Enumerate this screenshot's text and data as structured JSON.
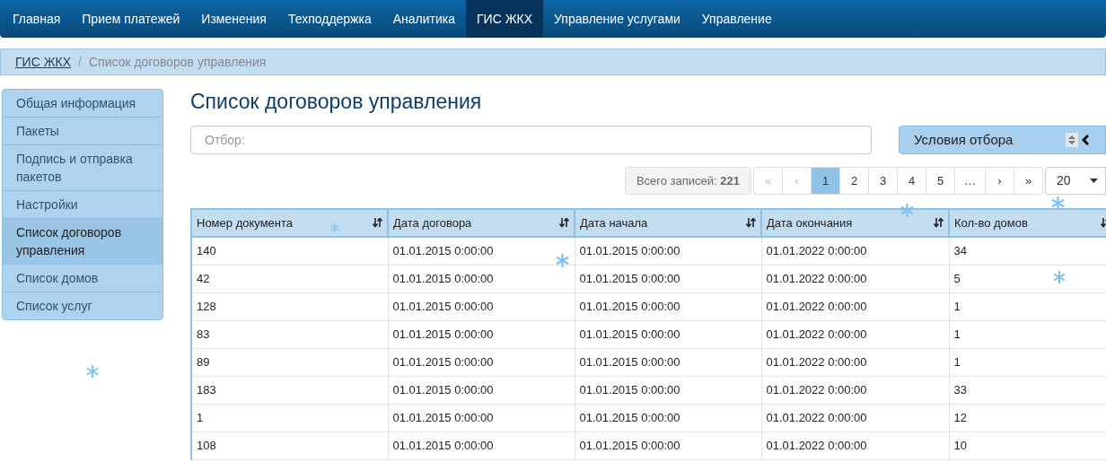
{
  "navbar": {
    "items": [
      {
        "label": "Главная",
        "selected": false
      },
      {
        "label": "Прием платежей",
        "selected": false
      },
      {
        "label": "Изменения",
        "selected": false
      },
      {
        "label": "Техподдержка",
        "selected": false
      },
      {
        "label": "Аналитика",
        "selected": false
      },
      {
        "label": "ГИС ЖКХ",
        "selected": true
      },
      {
        "label": "Управление услугами",
        "selected": false
      },
      {
        "label": "Управление",
        "selected": false
      }
    ]
  },
  "breadcrumb_separator": "/",
  "breadcrumb": [
    {
      "label": "ГИС ЖКХ",
      "kind": "link"
    },
    {
      "label": "Список договоров управления",
      "kind": "current"
    }
  ],
  "sidebar": {
    "items": [
      {
        "label": "Общая информация",
        "selected": false
      },
      {
        "label": "Пакеты",
        "selected": false
      },
      {
        "label": "Подпись и отправка пакетов",
        "selected": false
      },
      {
        "label": "Настройки",
        "selected": false
      },
      {
        "label": "Список договоров управления",
        "selected": true
      },
      {
        "label": "Список домов",
        "selected": false
      },
      {
        "label": "Список услуг",
        "selected": false
      }
    ]
  },
  "page_title": "Список договоров управления",
  "filter": {
    "placeholder": "Отбор:"
  },
  "conditions_button": "Условия отбора",
  "pagination": {
    "total": "Всего записей: **221**",
    "pages": [
      {
        "label": "«",
        "selected": false,
        "disabled": true
      },
      {
        "label": "‹",
        "selected": false,
        "disabled": true
      },
      {
        "label": "1",
        "selected": true,
        "disabled": false
      },
      {
        "label": "2",
        "selected": false,
        "disabled": false
      },
      {
        "label": "3",
        "selected": false,
        "disabled": false
      },
      {
        "label": "4",
        "selected": false,
        "disabled": false
      },
      {
        "label": "5",
        "selected": false,
        "disabled": false
      },
      {
        "label": "…",
        "selected": false,
        "disabled": false
      },
      {
        "label": "›",
        "selected": false,
        "disabled": false
      },
      {
        "label": "»",
        "selected": false,
        "disabled": false
      }
    ],
    "page_size": "20"
  },
  "table": {
    "columns": [
      "Номер документа",
      "Дата договора",
      "Дата начала",
      "Дата окончания",
      "Кол-во домов"
    ],
    "rows": [
      [
        "140",
        "01.01.2015 0:00:00",
        "01.01.2015 0:00:00",
        "01.01.2022 0:00:00",
        "34"
      ],
      [
        "42",
        "01.01.2015 0:00:00",
        "01.01.2015 0:00:00",
        "01.01.2022 0:00:00",
        "5"
      ],
      [
        "128",
        "01.01.2015 0:00:00",
        "01.01.2015 0:00:00",
        "01.01.2022 0:00:00",
        "1"
      ],
      [
        "83",
        "01.01.2015 0:00:00",
        "01.01.2015 0:00:00",
        "01.01.2022 0:00:00",
        "1"
      ],
      [
        "89",
        "01.01.2015 0:00:00",
        "01.01.2015 0:00:00",
        "01.01.2022 0:00:00",
        "1"
      ],
      [
        "183",
        "01.01.2015 0:00:00",
        "01.01.2015 0:00:00",
        "01.01.2022 0:00:00",
        "33"
      ],
      [
        "1",
        "01.01.2015 0:00:00",
        "01.01.2015 0:00:00",
        "01.01.2022 0:00:00",
        "12"
      ],
      [
        "108",
        "01.01.2015 0:00:00",
        "01.01.2015 0:00:00",
        "01.01.2022 0:00:00",
        "10"
      ]
    ]
  }
}
